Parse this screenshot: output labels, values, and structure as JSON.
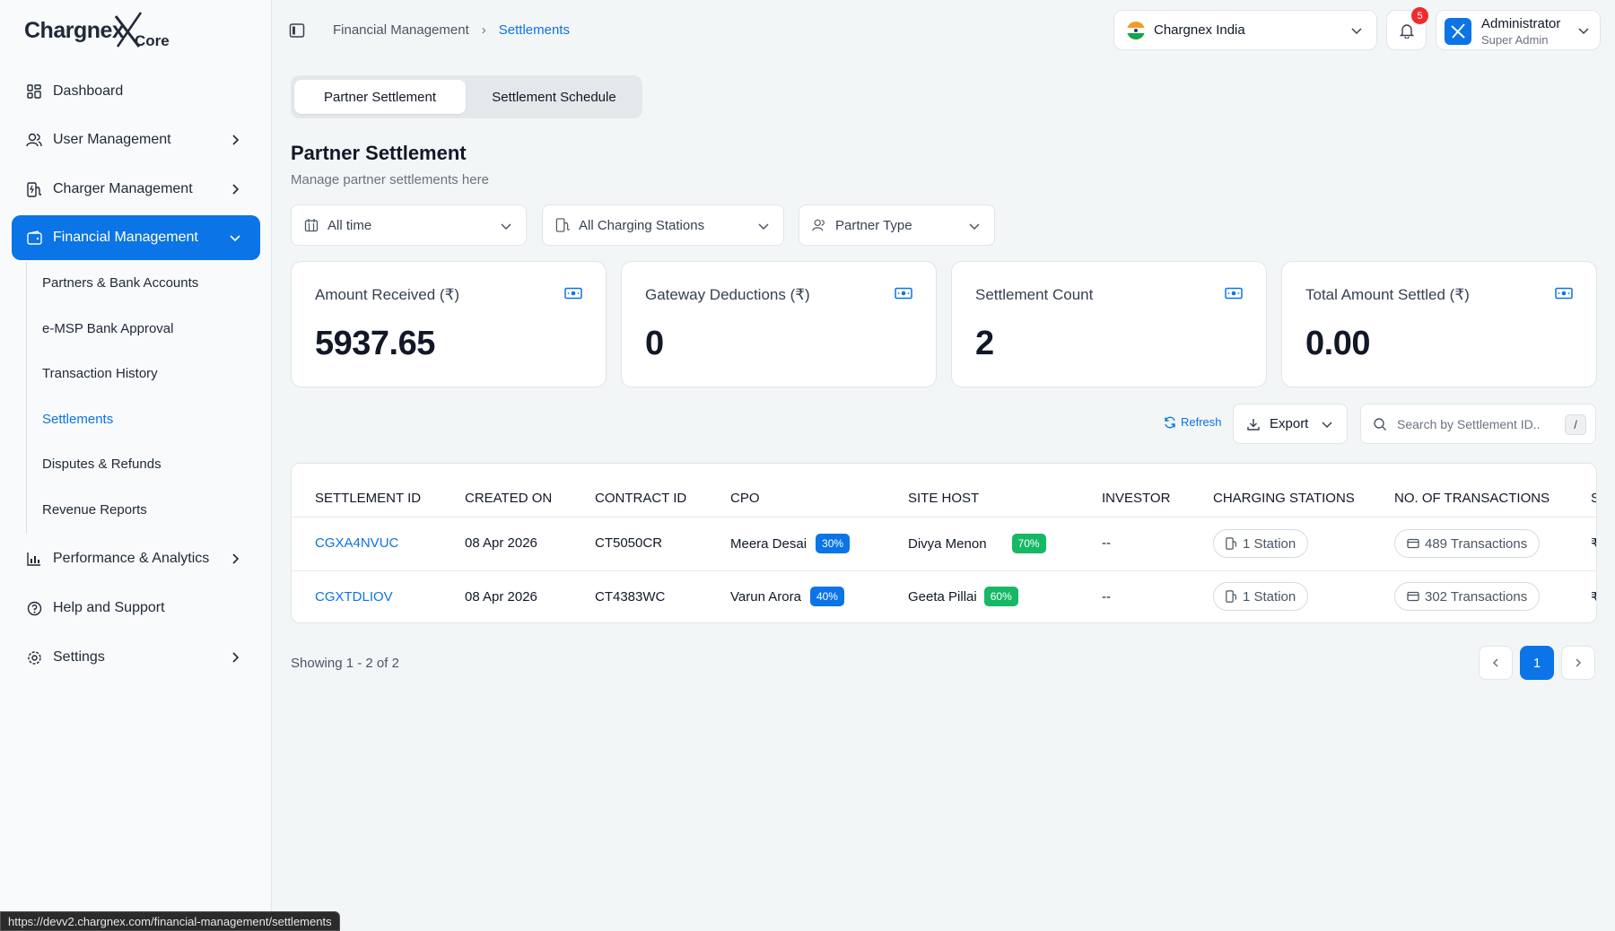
{
  "brand": {
    "name": "Chargnex",
    "suffix": "Core"
  },
  "sidebar": {
    "items": [
      {
        "label": "Dashboard",
        "icon": "dashboard-icon"
      },
      {
        "label": "User Management",
        "icon": "users-icon"
      },
      {
        "label": "Charger Management",
        "icon": "charger-icon"
      },
      {
        "label": "Financial Management",
        "icon": "wallet-icon"
      },
      {
        "label": "Performance & Analytics",
        "icon": "chart-icon"
      },
      {
        "label": "Help and Support",
        "icon": "help-icon"
      },
      {
        "label": "Settings",
        "icon": "gear-icon"
      }
    ],
    "sub_items": [
      {
        "label": "Partners & Bank Accounts"
      },
      {
        "label": "e-MSP Bank Approval"
      },
      {
        "label": "Transaction History"
      },
      {
        "label": "Settlements"
      },
      {
        "label": "Disputes & Refunds"
      },
      {
        "label": "Revenue Reports"
      }
    ]
  },
  "header": {
    "breadcrumb": [
      "Financial Management",
      "Settlements"
    ],
    "org": "Chargnex India",
    "notifications": "5",
    "user": {
      "name": "Administrator",
      "role": "Super Admin"
    }
  },
  "tabs": [
    {
      "label": "Partner Settlement",
      "active": true
    },
    {
      "label": "Settlement Schedule",
      "active": false
    }
  ],
  "page": {
    "title": "Partner Settlement",
    "subtitle": "Manage partner settlements here"
  },
  "filters": {
    "date": "All time",
    "stations": "All Charging Stations",
    "partner_type": "Partner Type"
  },
  "stats": [
    {
      "label": "Amount Received (₹)",
      "value": "5937.65"
    },
    {
      "label": "Gateway Deductions (₹)",
      "value": "0"
    },
    {
      "label": "Settlement Count",
      "value": "2"
    },
    {
      "label": "Total Amount Settled (₹)",
      "value": "0.00"
    }
  ],
  "actions": {
    "refresh": "Refresh",
    "export": "Export",
    "search_placeholder": "Search by Settlement ID..",
    "search_shortcut": "/"
  },
  "table": {
    "columns": [
      "SETTLEMENT ID",
      "CREATED ON",
      "CONTRACT ID",
      "CPO",
      "SITE HOST",
      "INVESTOR",
      "CHARGING STATIONS",
      "NO. OF TRANSACTIONS",
      "S"
    ],
    "rows": [
      {
        "id": "CGXA4NVUC",
        "created": "08 Apr 2026",
        "contract": "CT5050CR",
        "cpo": "Meera Desai",
        "cpo_pct": "30%",
        "host": "Divya Menon",
        "host_pct": "70%",
        "investor": "--",
        "stations": "1 Station",
        "transactions": "489 Transactions",
        "amount": "₹"
      },
      {
        "id": "CGXTDLIOV",
        "created": "08 Apr 2026",
        "contract": "CT4383WC",
        "cpo": "Varun Arora",
        "cpo_pct": "40%",
        "host": "Geeta Pillai",
        "host_pct": "60%",
        "investor": "--",
        "stations": "1 Station",
        "transactions": "302 Transactions",
        "amount": "₹"
      }
    ]
  },
  "pagination": {
    "showing": "Showing 1 - 2 of 2",
    "current": "1"
  },
  "status_url": "https://devv2.chargnex.com/financial-management/settlements",
  "colors": {
    "accent": "#0b74e6",
    "success": "#16b866",
    "danger": "#ef2b2b"
  }
}
